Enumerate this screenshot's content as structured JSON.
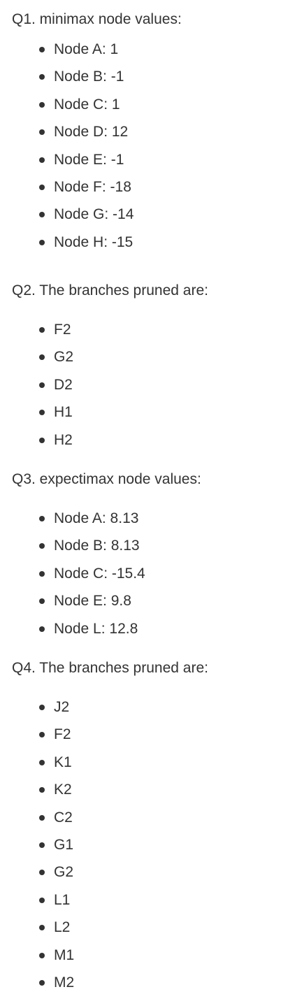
{
  "sections": [
    {
      "heading": "Q1. minimax node values:",
      "items": [
        "Node A: 1",
        "Node B: -1",
        "Node C: 1",
        "Node D: 12",
        "Node E: -1",
        "Node F: -18",
        "Node G: -14",
        "Node H: -15"
      ]
    },
    {
      "heading": "Q2. The branches pruned are:",
      "items": [
        "F2",
        "G2",
        "D2",
        "H1",
        "H2"
      ]
    },
    {
      "heading": "Q3. expectimax node values:",
      "items": [
        "Node A: 8.13",
        "Node B: 8.13",
        "Node C: -15.4",
        "Node E: 9.8",
        "Node L: 12.8"
      ]
    },
    {
      "heading": "Q4. The branches pruned are:",
      "items": [
        "J2",
        "F2",
        "K1",
        "K2",
        "C2",
        "G1",
        "G2",
        "L1",
        "L2",
        "M1",
        "M2"
      ]
    }
  ]
}
